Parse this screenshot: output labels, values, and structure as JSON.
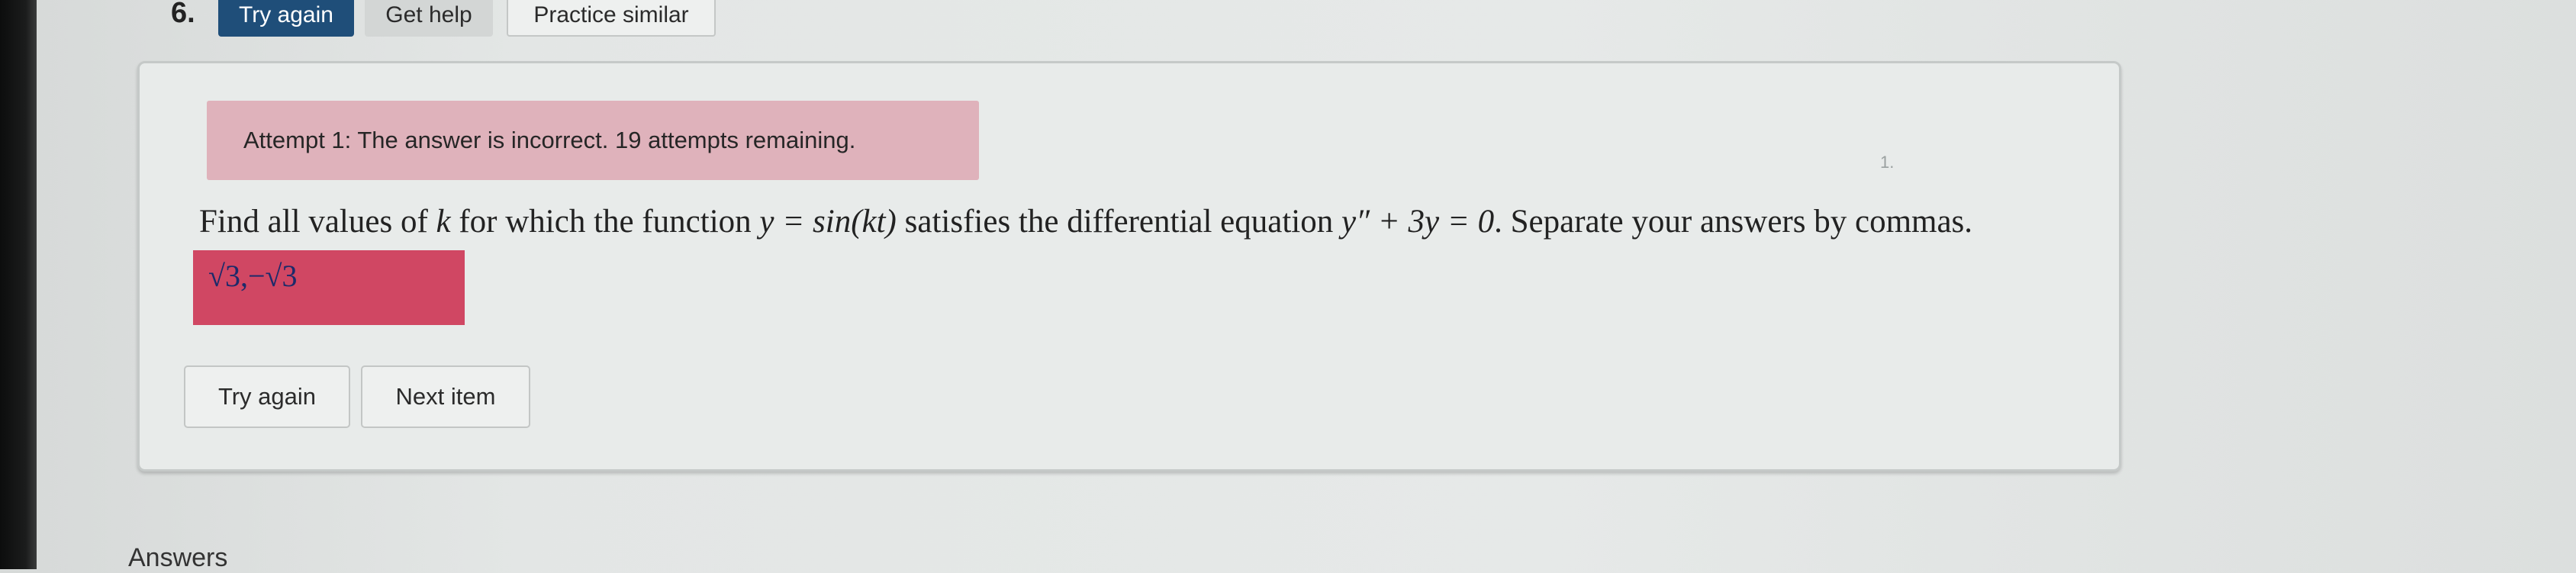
{
  "toolbar": {
    "question_number": "6.",
    "try_again_label": "Try again",
    "get_help_label": "Get help",
    "practice_similar_label": "Practice similar"
  },
  "question": {
    "attempt_message": "Attempt 1: The answer is incorrect. 19 attempts remaining.",
    "text_part1": "Find all values of ",
    "var_k": "k",
    "text_part2": " for which the function ",
    "function_expr": "y = sin(kt)",
    "text_part3": " satisfies the differential equation ",
    "equation_expr": "y″ + 3y = 0",
    "text_part4": ". Separate your answers by commas.",
    "answer_value": "√3,−√3",
    "try_again_label": "Try again",
    "next_item_label": "Next item",
    "corner_mark": "1."
  },
  "answers": {
    "heading": "Answers"
  },
  "colors": {
    "try_again_active": "#1f4e79",
    "incorrect_banner": "#dfb2bb",
    "incorrect_answer_field": "#d04763"
  }
}
